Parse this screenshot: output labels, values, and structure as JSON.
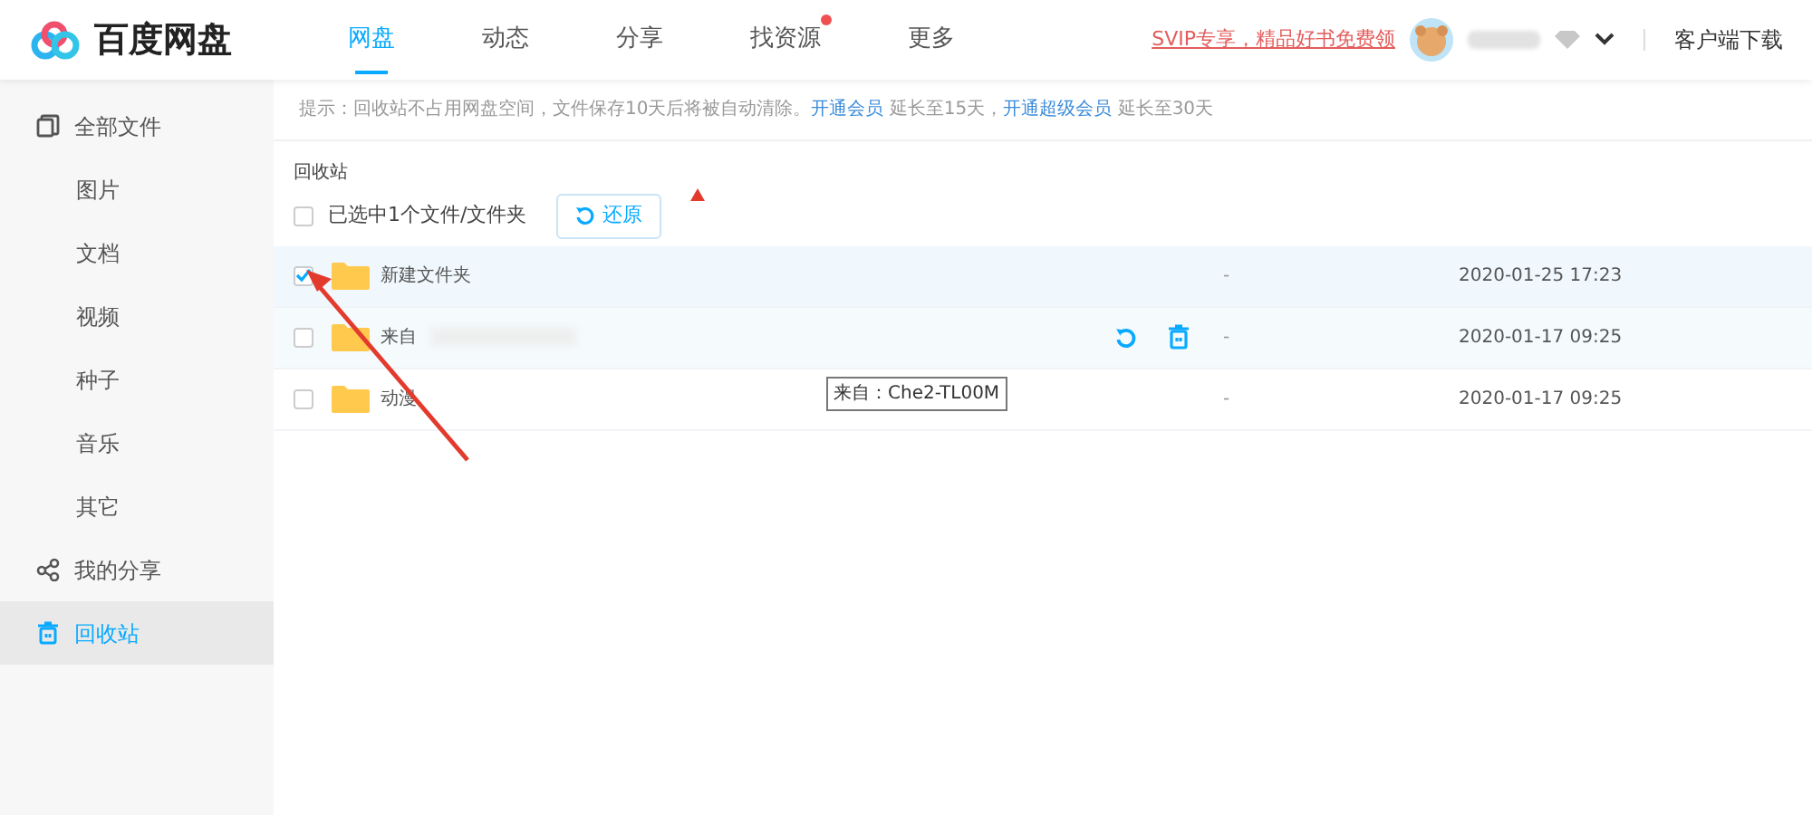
{
  "logo": {
    "text": "百度网盘"
  },
  "nav_tabs": [
    {
      "label": "网盘",
      "selected": true,
      "dot": false
    },
    {
      "label": "动态",
      "selected": false,
      "dot": false
    },
    {
      "label": "分享",
      "selected": false,
      "dot": false
    },
    {
      "label": "找资源",
      "selected": false,
      "dot": true
    },
    {
      "label": "更多",
      "selected": false,
      "dot": false
    }
  ],
  "promo_link": "SVIP专享，精品好书免费领",
  "client_download": "客户端下载",
  "sidebar": {
    "items": [
      {
        "label": "全部文件",
        "selected": false,
        "children": [
          {
            "label": "图片",
            "selected": false
          },
          {
            "label": "文档",
            "selected": false
          },
          {
            "label": "视频",
            "selected": false
          },
          {
            "label": "种子",
            "selected": false
          },
          {
            "label": "音乐",
            "selected": false
          },
          {
            "label": "其它",
            "selected": false
          }
        ]
      },
      {
        "label": "我的分享",
        "selected": false
      },
      {
        "label": "回收站",
        "selected": true
      }
    ]
  },
  "notice": {
    "parts": [
      {
        "kind": "text",
        "text": "提示：回收站不占用网盘空间，文件保存10天后将被自动清除。"
      },
      {
        "kind": "link",
        "text": "开通会员"
      },
      {
        "kind": "text",
        "text": " 延长至15天，"
      },
      {
        "kind": "link",
        "text": "开通超级会员"
      },
      {
        "kind": "text",
        "text": " 延长至30天"
      }
    ]
  },
  "breadcrumb": "回收站",
  "toolbar": {
    "select_all_checked": false,
    "selection_text": "已选中1个文件/文件夹",
    "restore_button": "还原"
  },
  "rows": [
    {
      "name": "新建文件夹",
      "checked": true,
      "hover": false,
      "size": "-",
      "date": "2020-01-25 17:23"
    },
    {
      "name": "来自",
      "checked": false,
      "hover": true,
      "size": "-",
      "date": "2020-01-17 09:25"
    },
    {
      "name": "动漫",
      "checked": false,
      "hover": false,
      "size": "-",
      "date": "2020-01-17 09:25"
    }
  ],
  "tooltip": "来自：Che2-TL00M"
}
